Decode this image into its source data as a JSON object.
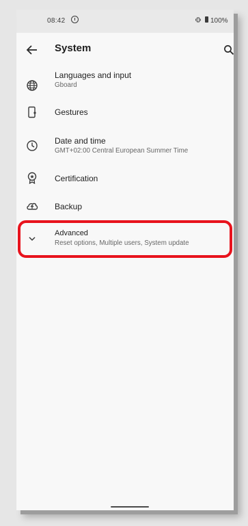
{
  "status_bar": {
    "time": "08:42",
    "battery": "100%",
    "icons": [
      "alert-icon",
      "vibrate-icon",
      "battery-icon"
    ]
  },
  "header": {
    "title": "System",
    "back_icon": "arrow-back-icon",
    "search_icon": "search-icon"
  },
  "settings": {
    "items": [
      {
        "label": "Languages and input",
        "sub": "Gboard",
        "icon": "globe-icon"
      },
      {
        "label": "Gestures",
        "sub": "",
        "icon": "phone-gesture-icon"
      },
      {
        "label": "Date and time",
        "sub": "GMT+02:00 Central European Summer Time",
        "icon": "clock-icon"
      },
      {
        "label": "Certification",
        "sub": "",
        "icon": "certificate-icon"
      },
      {
        "label": "Backup",
        "sub": "",
        "icon": "cloud-upload-icon"
      },
      {
        "label": "Advanced",
        "sub": "Reset options, Multiple users, System update",
        "icon": "chevron-down-icon"
      }
    ]
  },
  "colors": {
    "highlight": "#e8131d",
    "background": "#f8f8f8",
    "status_bar": "#e9e9e9"
  }
}
